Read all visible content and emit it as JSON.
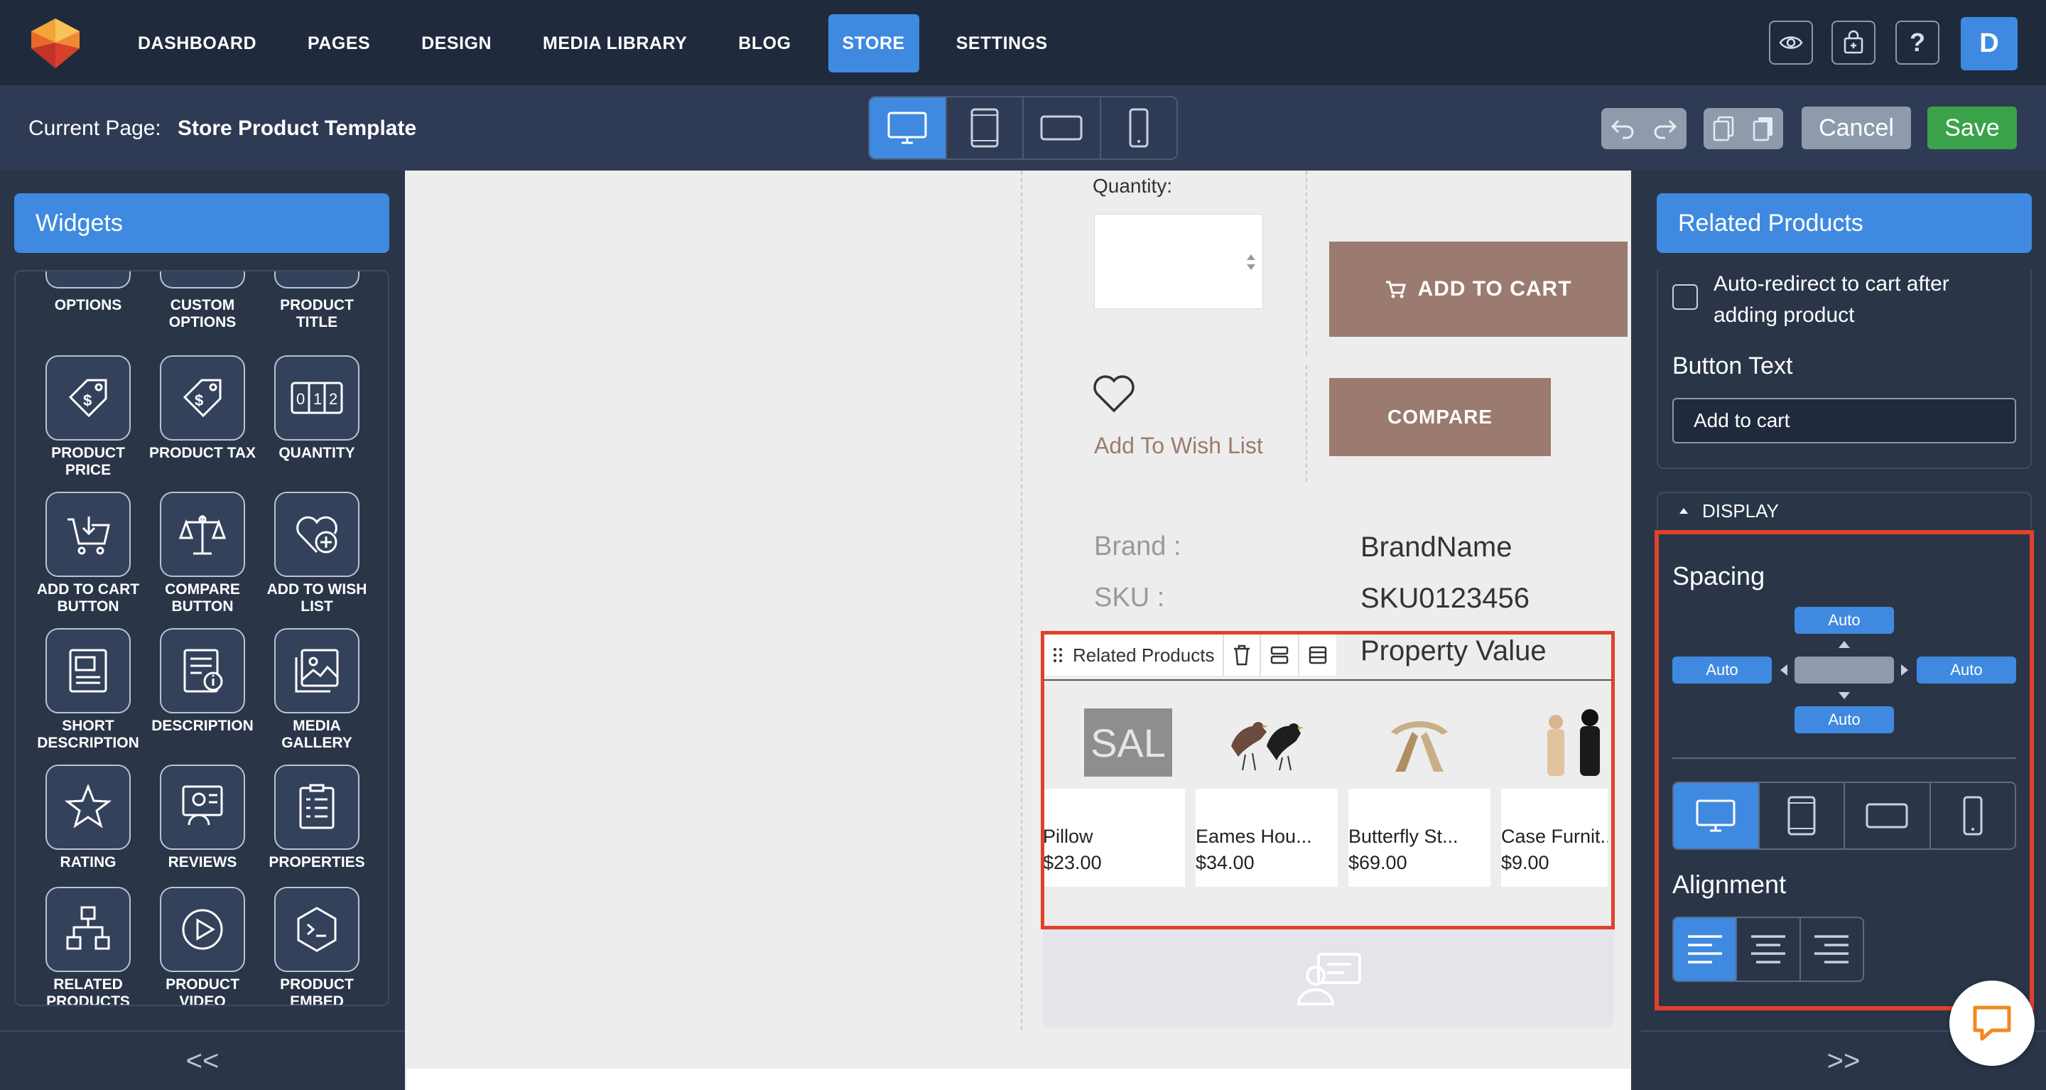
{
  "nav": {
    "items": [
      "DASHBOARD",
      "PAGES",
      "DESIGN",
      "MEDIA LIBRARY",
      "BLOG",
      "STORE",
      "SETTINGS"
    ],
    "active": "STORE",
    "avatar_initial": "D"
  },
  "subbar": {
    "current_page_label": "Current Page:",
    "current_page_value": "Store Product Template",
    "cancel_label": "Cancel",
    "save_label": "Save"
  },
  "left_panel": {
    "title": "Widgets",
    "partial_widgets": [
      "OPTIONS",
      "CUSTOM OPTIONS",
      "PRODUCT TITLE"
    ],
    "widgets": [
      {
        "label": "PRODUCT PRICE",
        "icon": "price-tag-icon"
      },
      {
        "label": "PRODUCT TAX",
        "icon": "tax-tag-icon"
      },
      {
        "label": "QUANTITY",
        "icon": "quantity-counter-icon"
      },
      {
        "label": "ADD TO CART BUTTON",
        "icon": "cart-icon"
      },
      {
        "label": "COMPARE BUTTON",
        "icon": "scale-icon"
      },
      {
        "label": "ADD TO WISH LIST",
        "icon": "heart-plus-icon"
      },
      {
        "label": "SHORT DESCRIPTION",
        "icon": "short-description-icon"
      },
      {
        "label": "DESCRIPTION",
        "icon": "description-icon"
      },
      {
        "label": "MEDIA GALLERY",
        "icon": "gallery-icon"
      },
      {
        "label": "RATING",
        "icon": "star-icon"
      },
      {
        "label": "REVIEWS",
        "icon": "reviews-icon"
      },
      {
        "label": "PROPERTIES",
        "icon": "properties-icon"
      },
      {
        "label": "RELATED PRODUCTS",
        "icon": "related-products-icon"
      },
      {
        "label": "PRODUCT VIDEO",
        "icon": "video-icon"
      },
      {
        "label": "PRODUCT EMBED",
        "icon": "embed-icon"
      }
    ],
    "collapse_label": "<<"
  },
  "canvas": {
    "quantity_label": "Quantity:",
    "add_to_cart_label": "ADD TO CART",
    "wish_list_label": "Add To Wish List",
    "compare_label": "COMPARE",
    "properties": [
      {
        "label": "Brand :",
        "value": "BrandName"
      },
      {
        "label": "SKU :",
        "value": "SKU0123456"
      }
    ],
    "property_value_text": "Property Value",
    "related_toolbar_label": "Related Products",
    "products": [
      {
        "name": "Pillow",
        "price": "$23.00",
        "image_text": "SAL"
      },
      {
        "name": "Eames Hou...",
        "price": "$34.00"
      },
      {
        "name": "Butterfly St...",
        "price": "$69.00"
      },
      {
        "name": "Case Furnit...",
        "price": "$9.00"
      }
    ]
  },
  "right_panel": {
    "title": "Related Products",
    "redirect_label": "Auto-redirect to cart after adding product",
    "redirect_checked": false,
    "button_text_label": "Button Text",
    "button_text_value": "Add to cart",
    "display_label": "DISPLAY",
    "spacing_label": "Spacing",
    "spacing": {
      "top": "Auto",
      "left": "Auto",
      "right": "Auto",
      "bottom": "Auto"
    },
    "alignment_label": "Alignment",
    "alignment_active": "left",
    "expand_label": ">>"
  },
  "colors": {
    "accent": "#3f8ae0",
    "save_green": "#3aa34a",
    "product_button": "#9b7b6f",
    "highlight": "#e0412a"
  }
}
